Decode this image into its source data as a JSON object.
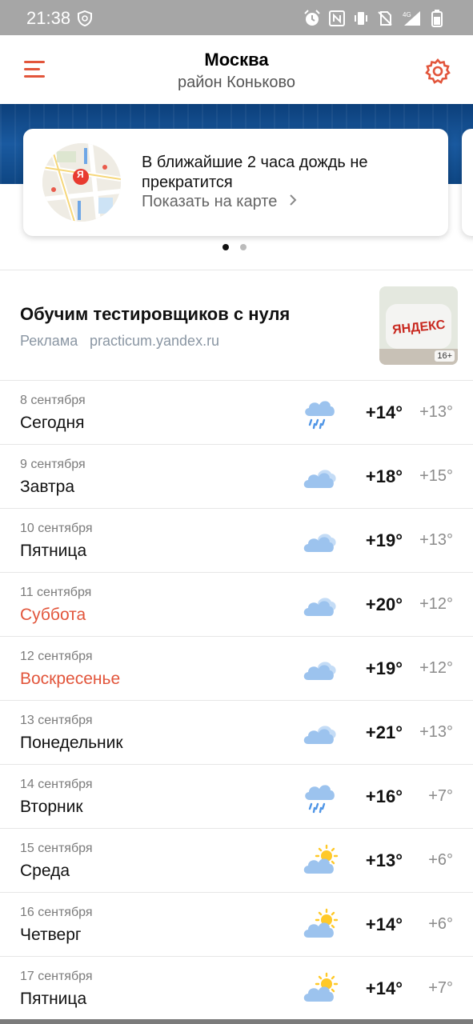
{
  "status_bar": {
    "time": "21:38",
    "network": "4G"
  },
  "header": {
    "city": "Москва",
    "district": "район Коньково"
  },
  "nowcast_card": {
    "message": "В ближайшие 2 часа дождь не прекратится",
    "link": "Показать на карте",
    "map_badge": "Я"
  },
  "carousel": {
    "pages": 2,
    "active": 1
  },
  "ad": {
    "title": "Обучим тестировщиков с нуля",
    "label": "Реклама",
    "domain": "practicum.yandex.ru",
    "age": "16+",
    "image_text": "ЯНДЕКС"
  },
  "forecast": [
    {
      "date": "8 сентября",
      "day": "Сегодня",
      "weekend": false,
      "icon": "rain-icon",
      "hi": "+14°",
      "lo": "+13°"
    },
    {
      "date": "9 сентября",
      "day": "Завтра",
      "weekend": false,
      "icon": "cloudy-icon",
      "hi": "+18°",
      "lo": "+15°"
    },
    {
      "date": "10 сентября",
      "day": "Пятница",
      "weekend": false,
      "icon": "cloudy-icon",
      "hi": "+19°",
      "lo": "+13°"
    },
    {
      "date": "11 сентября",
      "day": "Суббота",
      "weekend": true,
      "icon": "cloudy-icon",
      "hi": "+20°",
      "lo": "+12°"
    },
    {
      "date": "12 сентября",
      "day": "Воскресенье",
      "weekend": true,
      "icon": "cloudy-icon",
      "hi": "+19°",
      "lo": "+12°"
    },
    {
      "date": "13 сентября",
      "day": "Понедельник",
      "weekend": false,
      "icon": "cloudy-icon",
      "hi": "+21°",
      "lo": "+13°"
    },
    {
      "date": "14 сентября",
      "day": "Вторник",
      "weekend": false,
      "icon": "rain-icon",
      "hi": "+16°",
      "lo": "+7°"
    },
    {
      "date": "15 сентября",
      "day": "Среда",
      "weekend": false,
      "icon": "partly-cloudy-icon",
      "hi": "+13°",
      "lo": "+6°"
    },
    {
      "date": "16 сентября",
      "day": "Четверг",
      "weekend": false,
      "icon": "partly-cloudy-icon",
      "hi": "+14°",
      "lo": "+6°"
    },
    {
      "date": "17 сентября",
      "day": "Пятница",
      "weekend": false,
      "icon": "partly-cloudy-icon",
      "hi": "+14°",
      "lo": "+7°"
    }
  ],
  "colors": {
    "accent": "#e2553b",
    "icon_cloud": "#9cc3ee",
    "icon_sun": "#ffc929",
    "rain_drop": "#4f95e6"
  }
}
